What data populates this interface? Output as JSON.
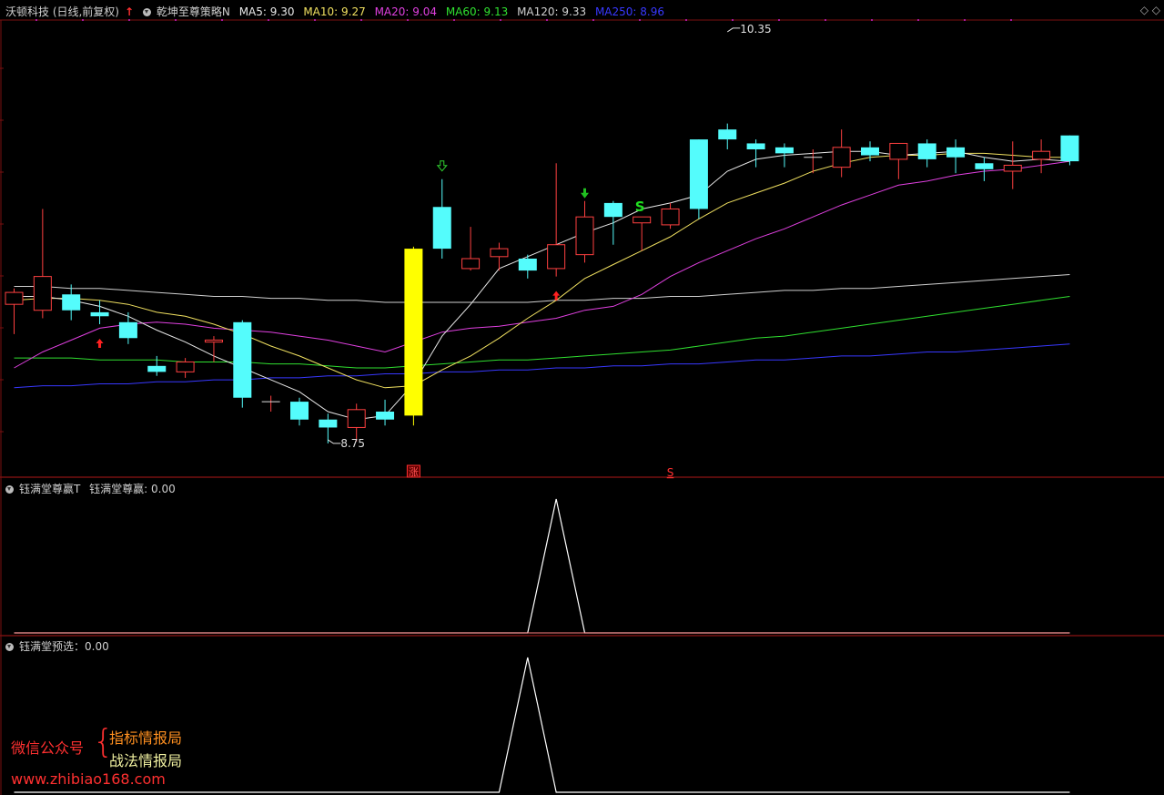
{
  "header": {
    "stock": "沃顿科技 (日线,前复权)",
    "strategy": "乾坤至尊策略N",
    "ma": [
      {
        "label": "MA5: 9.30",
        "color": "#e8e8e8"
      },
      {
        "label": "MA10: 9.27",
        "color": "#f0e060"
      },
      {
        "label": "MA20: 9.04",
        "color": "#e040e0"
      },
      {
        "label": "MA60: 9.13",
        "color": "#30e030"
      },
      {
        "label": "MA120: 9.33",
        "color": "#d0d0d0"
      },
      {
        "label": "MA250: 8.96",
        "color": "#3838ff"
      }
    ]
  },
  "panel2": {
    "title": "钰满堂尊赢T",
    "value": "钰满堂尊赢: 0.00"
  },
  "panel3": {
    "title": "钰满堂预选：0.00"
  },
  "watermark": {
    "line1": "微信公众号",
    "brace": "{",
    "item1": "指标情报局",
    "item2": "战法情报局",
    "url": "www.zhibiao168.com"
  },
  "chart_data": {
    "type": "candlestick",
    "high_label": "10.35",
    "low_label": "8.75",
    "marker_zhang": "涨",
    "marker_s": "S",
    "candles": [
      {
        "o": 8.96,
        "c": 9.02,
        "h": 9.04,
        "l": 8.81
      },
      {
        "o": 8.93,
        "c": 9.1,
        "h": 9.44,
        "l": 8.89
      },
      {
        "o": 9.01,
        "c": 8.93,
        "h": 9.06,
        "l": 8.88
      },
      {
        "o": 8.92,
        "c": 8.9,
        "h": 8.98,
        "l": 8.86
      },
      {
        "o": 8.87,
        "c": 8.79,
        "h": 8.92,
        "l": 8.76
      },
      {
        "o": 8.65,
        "c": 8.62,
        "h": 8.7,
        "l": 8.6
      },
      {
        "o": 8.62,
        "c": 8.67,
        "h": 8.69,
        "l": 8.59
      },
      {
        "o": 8.77,
        "c": 8.78,
        "h": 8.8,
        "l": 8.67
      },
      {
        "o": 8.87,
        "c": 8.49,
        "h": 8.88,
        "l": 8.44
      },
      {
        "o": 8.47,
        "c": 8.47,
        "h": 8.5,
        "l": 8.42
      },
      {
        "o": 8.47,
        "c": 8.38,
        "h": 8.49,
        "l": 8.35
      },
      {
        "o": 8.38,
        "c": 8.34,
        "h": 8.41,
        "l": 8.26
      },
      {
        "o": 8.34,
        "c": 8.43,
        "h": 8.46,
        "l": 8.27
      },
      {
        "o": 8.42,
        "c": 8.38,
        "h": 8.48,
        "l": 8.35
      },
      {
        "o": 8.4,
        "c": 9.24,
        "h": 9.25,
        "l": 8.35
      },
      {
        "o": 9.45,
        "c": 9.24,
        "h": 9.59,
        "l": 9.19
      },
      {
        "o": 9.14,
        "c": 9.19,
        "h": 9.35,
        "l": 9.13
      },
      {
        "o": 9.2,
        "c": 9.24,
        "h": 9.27,
        "l": 9.13
      },
      {
        "o": 9.19,
        "c": 9.13,
        "h": 9.21,
        "l": 9.09
      },
      {
        "o": 9.14,
        "c": 9.26,
        "h": 9.67,
        "l": 9.1
      },
      {
        "o": 9.21,
        "c": 9.4,
        "h": 9.48,
        "l": 9.17
      },
      {
        "o": 9.47,
        "c": 9.4,
        "h": 9.48,
        "l": 9.26
      },
      {
        "o": 9.37,
        "c": 9.4,
        "h": 9.4,
        "l": 9.23
      },
      {
        "o": 9.36,
        "c": 9.44,
        "h": 9.47,
        "l": 9.34
      },
      {
        "o": 9.79,
        "c": 9.44,
        "h": 9.79,
        "l": 9.39
      },
      {
        "o": 9.84,
        "c": 9.79,
        "h": 9.87,
        "l": 9.74
      },
      {
        "o": 9.77,
        "c": 9.74,
        "h": 9.79,
        "l": 9.65
      },
      {
        "o": 9.75,
        "c": 9.72,
        "h": 9.77,
        "l": 9.65
      },
      {
        "o": 9.7,
        "c": 9.7,
        "h": 9.74,
        "l": 9.62
      },
      {
        "o": 9.65,
        "c": 9.75,
        "h": 9.84,
        "l": 9.6
      },
      {
        "o": 9.75,
        "c": 9.71,
        "h": 9.78,
        "l": 9.68
      },
      {
        "o": 9.69,
        "c": 9.77,
        "h": 9.77,
        "l": 9.59
      },
      {
        "o": 9.77,
        "c": 9.69,
        "h": 9.79,
        "l": 9.65
      },
      {
        "o": 9.75,
        "c": 9.7,
        "h": 9.79,
        "l": 9.62
      },
      {
        "o": 9.67,
        "c": 9.64,
        "h": 9.7,
        "l": 9.58
      },
      {
        "o": 9.63,
        "c": 9.66,
        "h": 9.78,
        "l": 9.54
      },
      {
        "o": 9.69,
        "c": 9.73,
        "h": 9.79,
        "l": 9.62
      },
      {
        "o": 9.81,
        "c": 9.68,
        "h": 9.81,
        "l": 9.66
      }
    ],
    "up_arrows": [
      3,
      19
    ],
    "down_arrow_hollow": 15,
    "down_arrow_solid": 20,
    "s_index": 22,
    "zhang_index": 14,
    "s_bottom_index": 23,
    "ma5": [
      9.0,
      9.0,
      8.98,
      8.95,
      8.9,
      8.83,
      8.77,
      8.7,
      8.64,
      8.58,
      8.52,
      8.42,
      8.38,
      8.4,
      8.56,
      8.8,
      8.96,
      9.14,
      9.2,
      9.26,
      9.32,
      9.37,
      9.44,
      9.47,
      9.51,
      9.63,
      9.69,
      9.71,
      9.72,
      9.73,
      9.73,
      9.71,
      9.72,
      9.73,
      9.7,
      9.68,
      9.69,
      9.68
    ],
    "ma10": [
      8.98,
      8.99,
      8.99,
      8.98,
      8.96,
      8.92,
      8.9,
      8.86,
      8.81,
      8.75,
      8.7,
      8.64,
      8.58,
      8.54,
      8.55,
      8.63,
      8.7,
      8.79,
      8.89,
      8.98,
      9.09,
      9.16,
      9.23,
      9.3,
      9.39,
      9.47,
      9.52,
      9.57,
      9.63,
      9.67,
      9.7,
      9.71,
      9.71,
      9.72,
      9.72,
      9.71,
      9.7,
      9.7
    ],
    "ma20": [
      8.64,
      8.72,
      8.78,
      8.84,
      8.86,
      8.87,
      8.86,
      8.84,
      8.83,
      8.82,
      8.8,
      8.78,
      8.75,
      8.72,
      8.77,
      8.82,
      8.84,
      8.85,
      8.87,
      8.89,
      8.93,
      8.95,
      9.01,
      9.1,
      9.17,
      9.23,
      9.29,
      9.34,
      9.4,
      9.46,
      9.51,
      9.56,
      9.58,
      9.61,
      9.63,
      9.64,
      9.66,
      9.68
    ],
    "ma60": [
      8.69,
      8.69,
      8.69,
      8.68,
      8.68,
      8.68,
      8.67,
      8.67,
      8.67,
      8.66,
      8.66,
      8.65,
      8.64,
      8.64,
      8.65,
      8.66,
      8.67,
      8.68,
      8.68,
      8.69,
      8.7,
      8.71,
      8.72,
      8.73,
      8.75,
      8.77,
      8.79,
      8.8,
      8.82,
      8.84,
      8.86,
      8.88,
      8.9,
      8.92,
      8.94,
      8.96,
      8.98,
      9.0
    ],
    "ma120": [
      9.05,
      9.05,
      9.04,
      9.04,
      9.03,
      9.02,
      9.01,
      9.0,
      9.0,
      8.99,
      8.99,
      8.98,
      8.98,
      8.97,
      8.97,
      8.97,
      8.97,
      8.97,
      8.97,
      8.98,
      8.98,
      8.99,
      8.99,
      9.0,
      9.0,
      9.01,
      9.02,
      9.03,
      9.03,
      9.04,
      9.04,
      9.05,
      9.06,
      9.07,
      9.08,
      9.09,
      9.1,
      9.11
    ],
    "ma250": [
      8.54,
      8.55,
      8.55,
      8.56,
      8.56,
      8.57,
      8.57,
      8.58,
      8.58,
      8.59,
      8.59,
      8.6,
      8.6,
      8.61,
      8.61,
      8.62,
      8.62,
      8.63,
      8.63,
      8.64,
      8.64,
      8.65,
      8.65,
      8.66,
      8.66,
      8.67,
      8.68,
      8.68,
      8.69,
      8.7,
      8.7,
      8.71,
      8.72,
      8.72,
      8.73,
      8.74,
      8.75,
      8.76
    ],
    "ind1": [
      0,
      0,
      0,
      0,
      0,
      0,
      0,
      0,
      0,
      0,
      0,
      0,
      0,
      0,
      0,
      0,
      0,
      0,
      0,
      1,
      0,
      0,
      0,
      0,
      0,
      0,
      0,
      0,
      0,
      0,
      0,
      0,
      0,
      0,
      0,
      0,
      0,
      0
    ],
    "ind2": [
      0,
      0,
      0,
      0,
      0,
      0,
      0,
      0,
      0,
      0,
      0,
      0,
      0,
      0,
      0,
      0,
      0,
      0,
      1,
      0,
      0,
      0,
      0,
      0,
      0,
      0,
      0,
      0,
      0,
      0,
      0,
      0,
      0,
      0,
      0,
      0,
      0,
      0
    ],
    "colors": {
      "up": "#ff4040",
      "down": "#54fcfc",
      "limit": "#ffff00"
    }
  }
}
